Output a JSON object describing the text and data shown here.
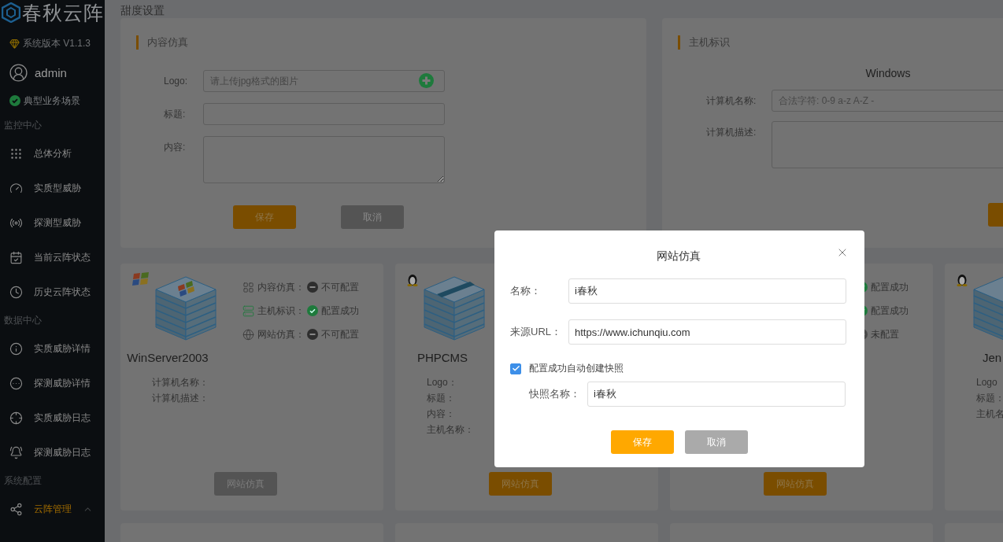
{
  "sidebar": {
    "logo": "春秋云阵",
    "version": "系统版本 V1.1.3",
    "user": "admin",
    "scenario": "典型业务场景",
    "sections": [
      {
        "title": "监控中心",
        "items": [
          {
            "label": "总体分析",
            "selected": false
          },
          {
            "label": "实质型威胁",
            "selected": false
          },
          {
            "label": "探测型威胁",
            "selected": false
          },
          {
            "label": "当前云阵状态",
            "selected": false
          },
          {
            "label": "历史云阵状态",
            "selected": false
          }
        ]
      },
      {
        "title": "数据中心",
        "items": [
          {
            "label": "实质威胁详情",
            "selected": false
          },
          {
            "label": "探测威胁详情",
            "selected": false
          },
          {
            "label": "实质威胁日志",
            "selected": false
          },
          {
            "label": "探测威胁日志",
            "selected": false
          }
        ]
      },
      {
        "title": "系统配置",
        "items": [
          {
            "label": "云阵管理",
            "selected": true,
            "expanded": true
          }
        ]
      }
    ]
  },
  "page_title": "甜度设置",
  "content_panel": {
    "title": "内容仿真",
    "fields": [
      {
        "label": "Logo:",
        "placeholder": "请上传jpg格式的图片",
        "kind": "upload"
      },
      {
        "label": "标题:",
        "kind": "text"
      },
      {
        "label": "内容:",
        "kind": "textarea"
      }
    ],
    "buttons": [
      {
        "label": "保存",
        "kind": "primary"
      },
      {
        "label": "取消",
        "kind": "secondary"
      }
    ]
  },
  "host_panel": {
    "title": "主机标识",
    "os": "Windows",
    "fields": [
      {
        "label": "计算机名称:",
        "placeholder": "合法字符: 0-9 a-z A-Z -",
        "kind": "text"
      },
      {
        "label": "计算机描述:",
        "kind": "textarea"
      }
    ],
    "buttons": [
      {
        "kind": "primary"
      }
    ]
  },
  "hosts": [
    {
      "kind": "windows",
      "name": "WinServer2003",
      "details": [
        "计算机名称：",
        "计算机描述："
      ],
      "statuses": [
        {
          "label": "内容仿真：",
          "kind": "unavailable",
          "value": "不可配置"
        },
        {
          "label": "主机标识：",
          "kind": "success",
          "value": "配置成功"
        },
        {
          "label": "网站仿真：",
          "kind": "unavailable",
          "value": "不可配置"
        }
      ],
      "button": {
        "label": "网站仿真",
        "disabled": true
      }
    },
    {
      "kind": "linux",
      "name": "PHPCMS",
      "details": [
        "Logo：",
        "标题：",
        "内容：",
        "主机名称："
      ],
      "button": {
        "label": "网站仿真",
        "disabled": false
      }
    },
    {
      "statuses": [
        {
          "kind": "success",
          "value": "配置成功"
        },
        {
          "kind": "success",
          "value": "配置成功"
        },
        {
          "kind": "unset",
          "value": "未配置"
        }
      ],
      "button": {
        "label": "网站仿真",
        "disabled": false
      }
    },
    {
      "kind": "linux",
      "name": "Jen",
      "details": [
        "Logo",
        "标题：",
        "主机名"
      ]
    }
  ],
  "dialog": {
    "title": "网站仿真",
    "fields": [
      {
        "label": "名称：",
        "value": "i春秋"
      },
      {
        "label": "来源URL：",
        "value": "https://www.ichunqiu.com"
      }
    ],
    "snapshot": {
      "label": "配置成功自动创建快照",
      "checked": true,
      "field": {
        "label": "快照名称：",
        "value": "i春秋"
      }
    },
    "buttons": [
      {
        "label": "保存",
        "kind": "primary"
      },
      {
        "label": "取消",
        "kind": "secondary"
      }
    ]
  }
}
